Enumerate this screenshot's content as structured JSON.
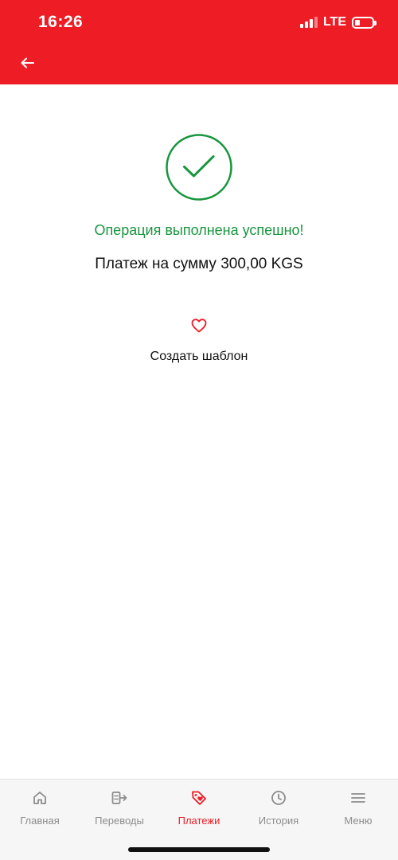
{
  "status_bar": {
    "time": "16:26",
    "network": "LTE"
  },
  "header": {
    "back_icon": "arrow-left-icon"
  },
  "result": {
    "icon": "check-circle-icon",
    "title": "Операция выполнена успешно!",
    "amount_text": "Платеж на сумму 300,00 KGS"
  },
  "template": {
    "icon": "heart-icon",
    "label": "Создать шаблон"
  },
  "bottom_nav": {
    "items": [
      {
        "label": "Главная",
        "icon": "home-icon"
      },
      {
        "label": "Переводы",
        "icon": "transfer-icon"
      },
      {
        "label": "Платежи",
        "icon": "payment-tag-icon",
        "active": true
      },
      {
        "label": "История",
        "icon": "clock-icon"
      },
      {
        "label": "Меню",
        "icon": "menu-icon"
      }
    ]
  },
  "colors": {
    "brand_red": "#ee1c25",
    "success_green": "#18963e",
    "nav_inactive": "#8c8c8c"
  }
}
